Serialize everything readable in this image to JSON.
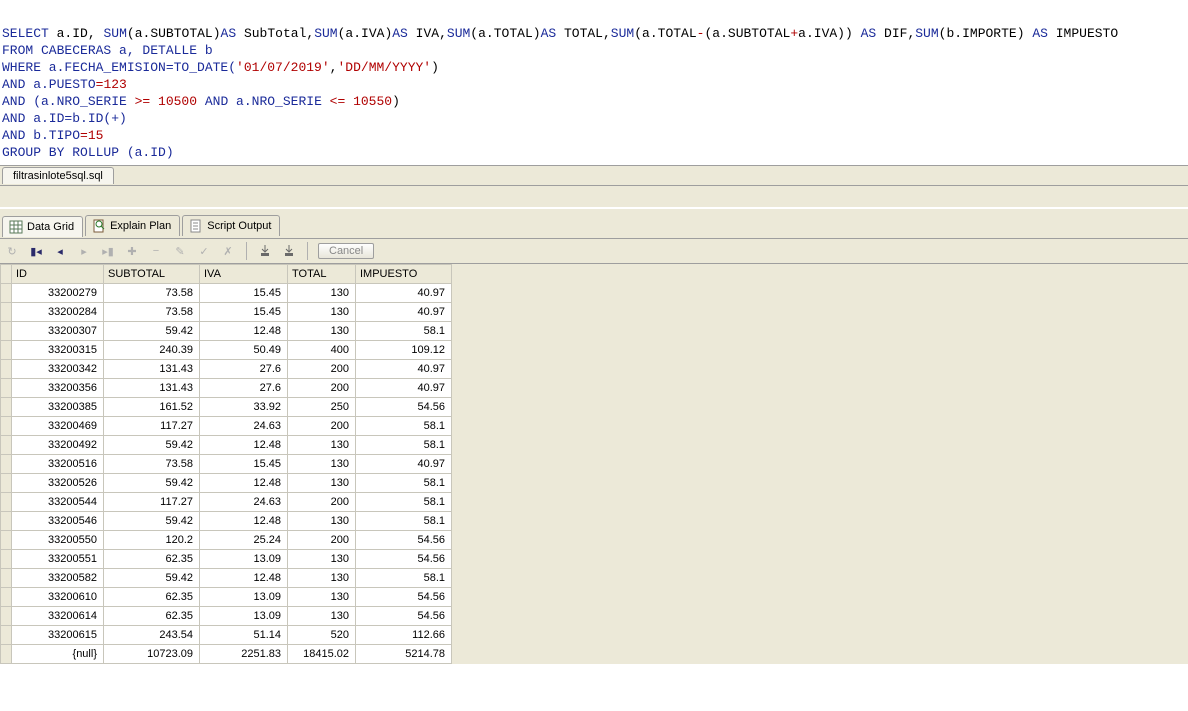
{
  "sql": {
    "line1_parts": [
      "SELECT",
      " a",
      ".",
      "ID",
      ", ",
      "SUM",
      "(",
      "a",
      ".",
      "SUBTOTAL",
      ")",
      "AS",
      " SubTotal",
      ",",
      "SUM",
      "(",
      "a",
      ".",
      "IVA",
      ")",
      "AS",
      " IVA",
      ",",
      "SUM",
      "(",
      "a",
      ".",
      "TOTAL",
      ")",
      "AS",
      " TOTAL",
      ",",
      "SUM",
      "(",
      "a",
      ".",
      "TOTAL",
      "-",
      "(",
      "a",
      ".",
      "SUBTOTAL",
      "+",
      "a",
      ".",
      "IVA",
      ")",
      ")",
      " ",
      "AS",
      " DIF",
      ",",
      "SUM",
      "(",
      "b",
      ".",
      "IMPORTE",
      ")",
      " ",
      "AS",
      " IMPUESTO"
    ],
    "line2": "FROM CABECERAS a, DETALLE b",
    "line3_a": "WHERE a.FECHA_EMISION=TO_DATE(",
    "line3_b": "'01/07/2019'",
    "line3_c": ",",
    "line3_d": "'DD/MM/YYYY'",
    "line3_e": ")",
    "line4_a": "AND a.PUESTO",
    "line4_b": "=",
    "line4_c": "123",
    "line5_a": "AND (a.NRO_SERIE ",
    "line5_b": ">= ",
    "line5_c": "10500",
    "line5_d": " AND a.NRO_SERIE ",
    "line5_e": "<= ",
    "line5_f": "10550",
    "line5_g": ")",
    "line6": "AND a.ID=b.ID(+)",
    "line7_a": "AND b.TIPO",
    "line7_b": "=",
    "line7_c": "15",
    "line8": "GROUP BY ROLLUP (a.ID)"
  },
  "file_tab": "filtrasinlote5sql.sql",
  "tabs": {
    "data_grid": "Data Grid",
    "explain_plan": "Explain Plan",
    "script_output": "Script Output"
  },
  "toolbar": {
    "cancel": "Cancel"
  },
  "columns": [
    "ID",
    "SUBTOTAL",
    "IVA",
    "TOTAL",
    "IMPUESTO"
  ],
  "rows": [
    [
      "33200279",
      "73.58",
      "15.45",
      "130",
      "40.97"
    ],
    [
      "33200284",
      "73.58",
      "15.45",
      "130",
      "40.97"
    ],
    [
      "33200307",
      "59.42",
      "12.48",
      "130",
      "58.1"
    ],
    [
      "33200315",
      "240.39",
      "50.49",
      "400",
      "109.12"
    ],
    [
      "33200342",
      "131.43",
      "27.6",
      "200",
      "40.97"
    ],
    [
      "33200356",
      "131.43",
      "27.6",
      "200",
      "40.97"
    ],
    [
      "33200385",
      "161.52",
      "33.92",
      "250",
      "54.56"
    ],
    [
      "33200469",
      "117.27",
      "24.63",
      "200",
      "58.1"
    ],
    [
      "33200492",
      "59.42",
      "12.48",
      "130",
      "58.1"
    ],
    [
      "33200516",
      "73.58",
      "15.45",
      "130",
      "40.97"
    ],
    [
      "33200526",
      "59.42",
      "12.48",
      "130",
      "58.1"
    ],
    [
      "33200544",
      "117.27",
      "24.63",
      "200",
      "58.1"
    ],
    [
      "33200546",
      "59.42",
      "12.48",
      "130",
      "58.1"
    ],
    [
      "33200550",
      "120.2",
      "25.24",
      "200",
      "54.56"
    ],
    [
      "33200551",
      "62.35",
      "13.09",
      "130",
      "54.56"
    ],
    [
      "33200582",
      "59.42",
      "12.48",
      "130",
      "58.1"
    ],
    [
      "33200610",
      "62.35",
      "13.09",
      "130",
      "54.56"
    ],
    [
      "33200614",
      "62.35",
      "13.09",
      "130",
      "54.56"
    ],
    [
      "33200615",
      "243.54",
      "51.14",
      "520",
      "112.66"
    ],
    [
      "{null}",
      "10723.09",
      "2251.83",
      "18415.02",
      "5214.78"
    ]
  ]
}
